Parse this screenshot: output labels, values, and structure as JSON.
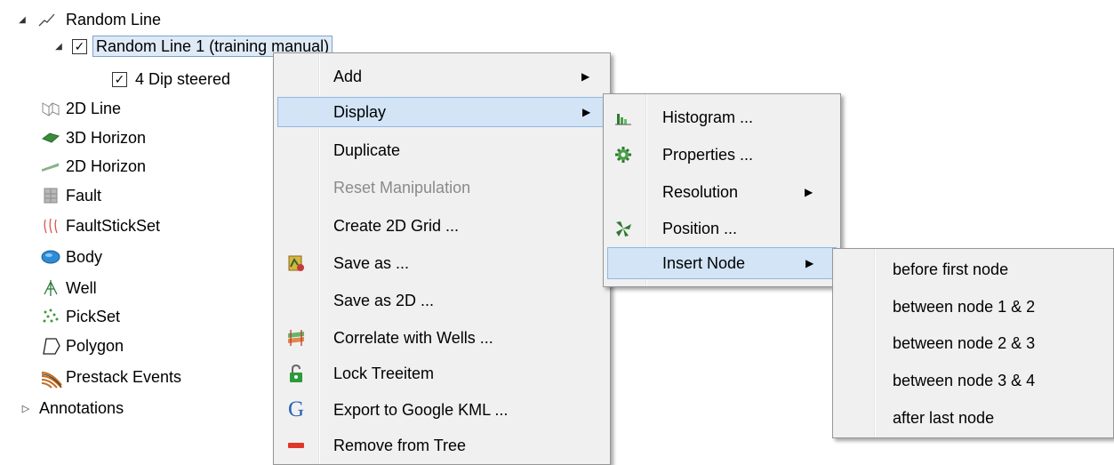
{
  "tree": {
    "random_line": "Random Line",
    "random_line_1": "Random Line 1 (training manual)",
    "dip_steered": "4 Dip steered",
    "items": [
      "2D Line",
      "3D Horizon",
      "2D Horizon",
      "Fault",
      "FaultStickSet",
      "Body",
      "Well",
      "PickSet",
      "Polygon",
      "Prestack Events"
    ],
    "annotations": "Annotations"
  },
  "context_menu": {
    "add": "Add",
    "display": "Display",
    "duplicate": "Duplicate",
    "reset_manipulation": "Reset Manipulation",
    "create_2d_grid": "Create 2D Grid ...",
    "save_as": "Save as ...",
    "save_as_2d": "Save as 2D ...",
    "correlate_with_wells": "Correlate with Wells ...",
    "lock_treeitem": "Lock Treeitem",
    "export_kml": "Export to Google KML ...",
    "remove_from_tree": "Remove from Tree"
  },
  "display_menu": {
    "histogram": "Histogram ...",
    "properties": "Properties ...",
    "resolution": "Resolution",
    "position": "Position ...",
    "insert_node": "Insert Node"
  },
  "insert_node_menu": {
    "items": [
      "before first node",
      "between node 1 & 2",
      "between node 2 & 3",
      "between node 3 & 4",
      "after last node"
    ]
  },
  "icons": {
    "google_letter": "G"
  },
  "colors": {
    "highlight_bg": "#d2e4f6",
    "highlight_border": "#8fb7e4",
    "menu_bg": "#f0f0f0"
  }
}
